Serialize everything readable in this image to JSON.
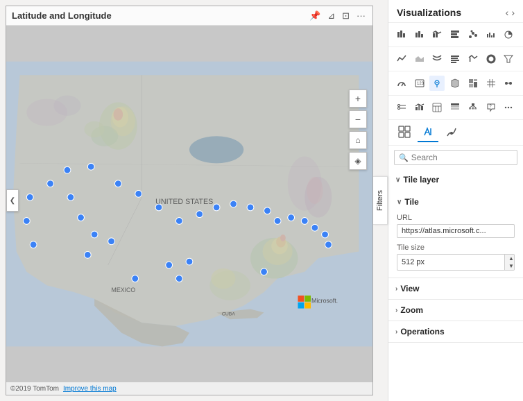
{
  "panel": {
    "title": "Visualizations",
    "arrow_left": "‹",
    "arrow_right": "›"
  },
  "search": {
    "placeholder": "Search",
    "value": ""
  },
  "sections": {
    "tile_layer": {
      "label": "Tile layer"
    },
    "tile": {
      "label": "Tile",
      "url_label": "URL",
      "url_value": "https://atlas.microsoft.c...",
      "size_label": "Tile size",
      "size_value": "512 px"
    },
    "view": {
      "label": "View"
    },
    "zoom": {
      "label": "Zoom"
    },
    "operations": {
      "label": "Operations"
    }
  },
  "map": {
    "title": "Latitude and Longitude",
    "footer": "©2019 TomTom",
    "improve_link": "Improve this map",
    "controls": {
      "pan_left": "❮",
      "zoom_in": "+",
      "zoom_out": "−",
      "home": "⌂",
      "compass": "◈"
    }
  },
  "filters_tab": {
    "label": "Filters"
  },
  "viz_tabs": {
    "fields_icon": "▦",
    "format_icon": "🖌",
    "analytics_icon": "✋"
  },
  "toolbar_icons": {
    "focus": "⊞",
    "filter": "⊿",
    "more": "..."
  }
}
